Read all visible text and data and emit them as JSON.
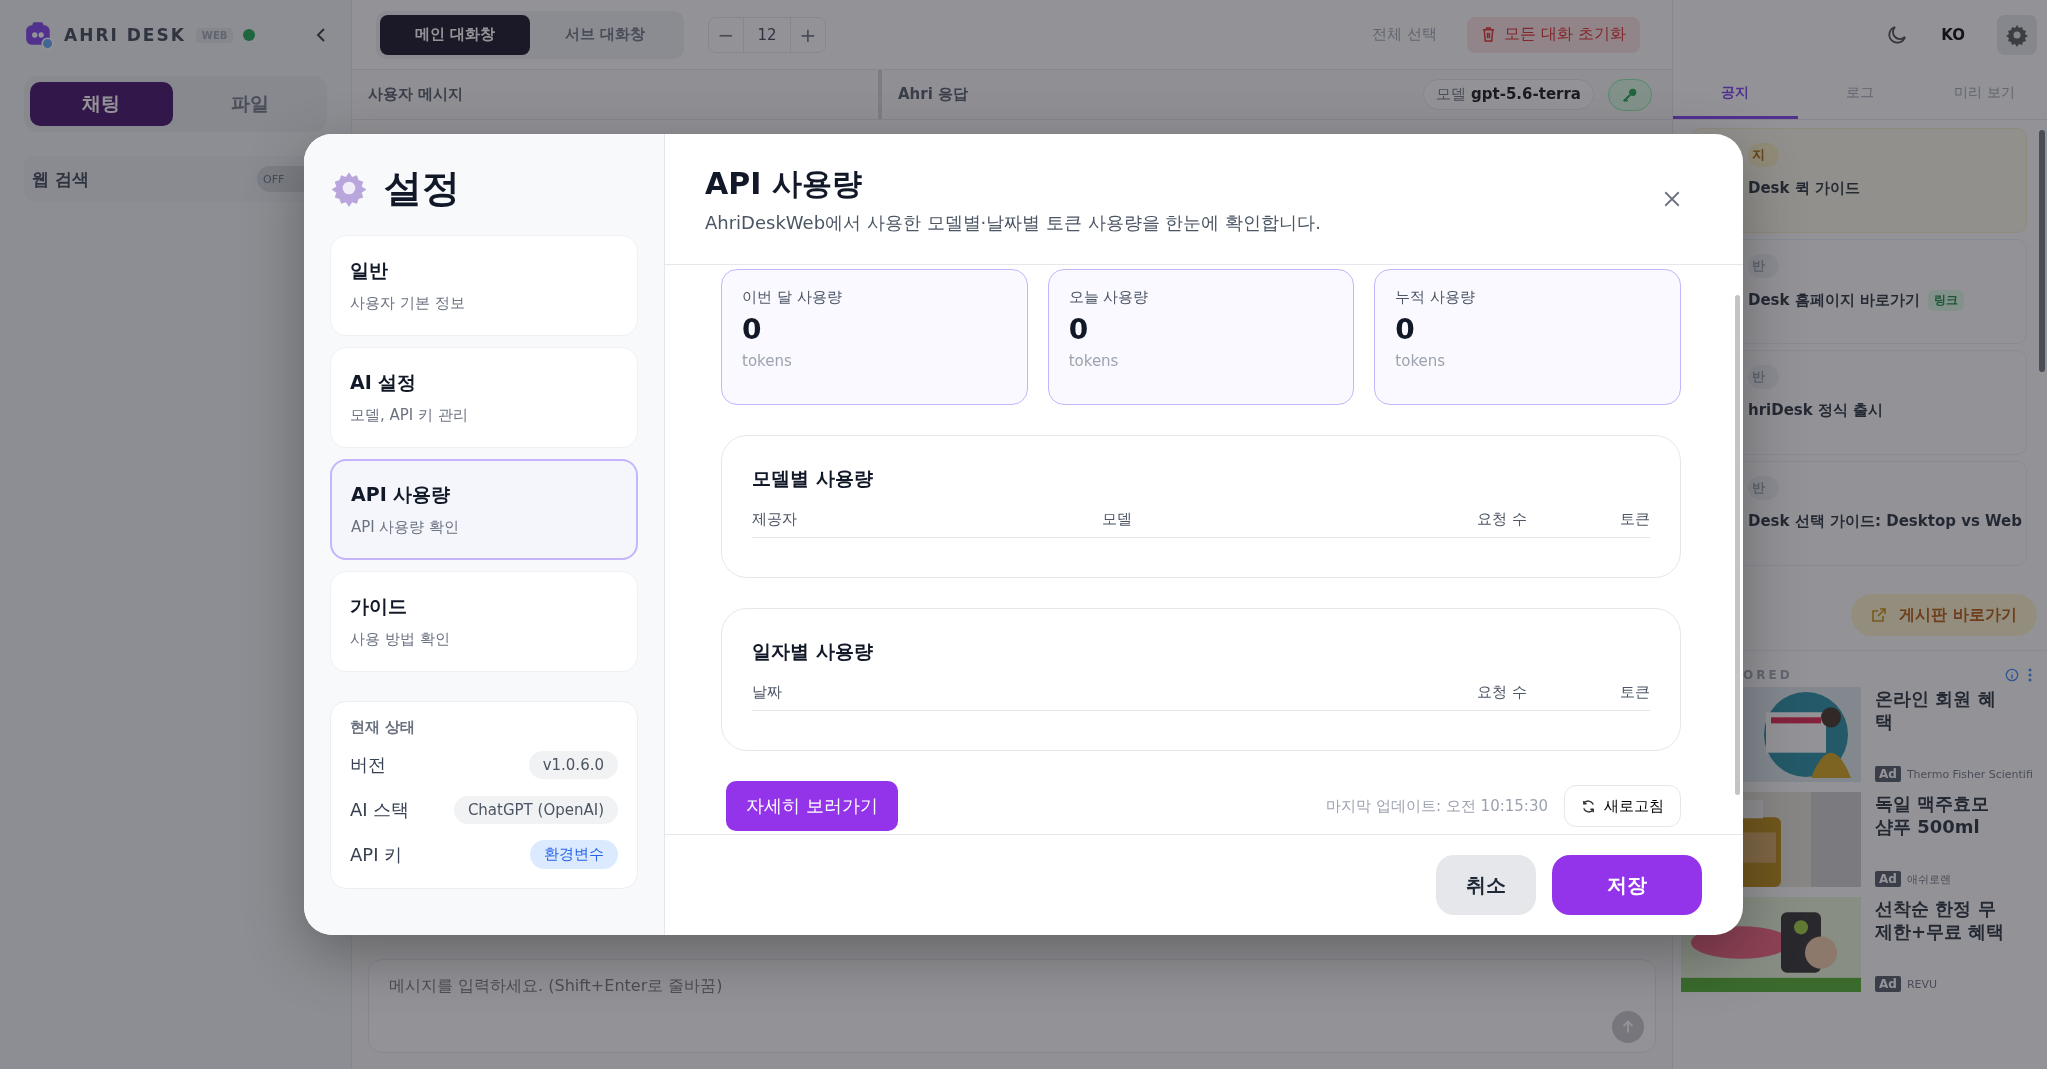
{
  "sidebar": {
    "logo": "AHRI DESK",
    "badge": "WEB",
    "online": true,
    "tabs": [
      {
        "label": "채팅",
        "selected": true
      },
      {
        "label": "파일",
        "selected": false
      }
    ],
    "web_search": {
      "label": "웹 검색",
      "on": false,
      "state_text": "OFF"
    }
  },
  "toolbar": {
    "views": [
      {
        "label": "메인 대화창",
        "selected": true
      },
      {
        "label": "서브 대화창",
        "selected": false
      }
    ],
    "font_size": {
      "minus": "−",
      "value": "12",
      "plus": "+"
    },
    "select_all": "전체 선택",
    "reset": "모든 대화 초기화"
  },
  "chat": {
    "columns": [
      "사용자 메시지",
      "Ahri 응답"
    ],
    "model_label": "모델",
    "model": "gpt-5.6-terra",
    "input_placeholder": "메시지를 입력하세요. (Shift+Enter로 줄바꿈)"
  },
  "right_panel": {
    "language": "KO",
    "tabs": [
      {
        "label": "공지",
        "selected": true
      },
      {
        "label": "로그",
        "selected": false
      },
      {
        "label": "미리 보기",
        "selected": false
      }
    ],
    "notices": [
      {
        "kind": "pinned",
        "badge": "지",
        "title": "Desk 퀵 가이드"
      },
      {
        "kind": "normal",
        "badge": "반",
        "title": "Desk 홈페이지 바로가기",
        "tag": "링크"
      },
      {
        "kind": "normal",
        "badge": "반",
        "title": "hriDesk 정식 출시"
      },
      {
        "kind": "normal",
        "badge": "반",
        "title": "Desk 선택 가이드: Desktop vs Web"
      }
    ],
    "board_button": "게시판 바로가기",
    "sponsored": "ORED",
    "ads": [
      {
        "title": "온라인 회원 혜택",
        "ad": "Ad",
        "advertiser": "Thermo Fisher Scientifi"
      },
      {
        "title": "독일 맥주효모 샴푸 500ml",
        "ad": "Ad",
        "advertiser": "애쉬로렌"
      },
      {
        "title": "선착순 한정 무제한+무료 혜택",
        "ad": "Ad",
        "advertiser": "REVU"
      }
    ]
  },
  "settings": {
    "title": "설정",
    "menu": [
      {
        "title": "일반",
        "subtitle": "사용자 기본 정보",
        "selected": false
      },
      {
        "title": "AI 설정",
        "subtitle": "모델, API 키 관리",
        "selected": false
      },
      {
        "title": "API 사용량",
        "subtitle": "API 사용량 확인",
        "selected": true
      },
      {
        "title": "가이드",
        "subtitle": "사용 방법 확인",
        "selected": false
      }
    ],
    "status": {
      "title": "현재 상태",
      "rows": [
        {
          "label": "버전",
          "value": "v1.0.6.0",
          "kind": "plain"
        },
        {
          "label": "AI 스택",
          "value": "ChatGPT (OpenAI)",
          "kind": "plain"
        },
        {
          "label": "API 키",
          "value": "환경변수",
          "kind": "info"
        }
      ]
    },
    "page": {
      "title": "API 사용량",
      "subtitle": "AhriDeskWeb에서 사용한 모델별·날짜별 토큰 사용량을 한눈에 확인합니다.",
      "stats": [
        {
          "label": "이번 달 사용량",
          "value": "0",
          "unit": "tokens"
        },
        {
          "label": "오늘 사용량",
          "value": "0",
          "unit": "tokens"
        },
        {
          "label": "누적 사용량",
          "value": "0",
          "unit": "tokens"
        }
      ],
      "model_usage": {
        "title": "모델별 사용량",
        "columns": [
          "제공자",
          "모델",
          "요청 수",
          "토큰"
        ]
      },
      "daily_usage": {
        "title": "일자별 사용량",
        "columns": [
          "날짜",
          "요청 수",
          "토큰"
        ]
      },
      "details_button": "자세히 보러가기",
      "last_update": "마지막 업데이트: 오전 10:15:30",
      "refresh_button": "새로고침"
    },
    "buttons": {
      "cancel": "취소",
      "save": "저장"
    }
  }
}
